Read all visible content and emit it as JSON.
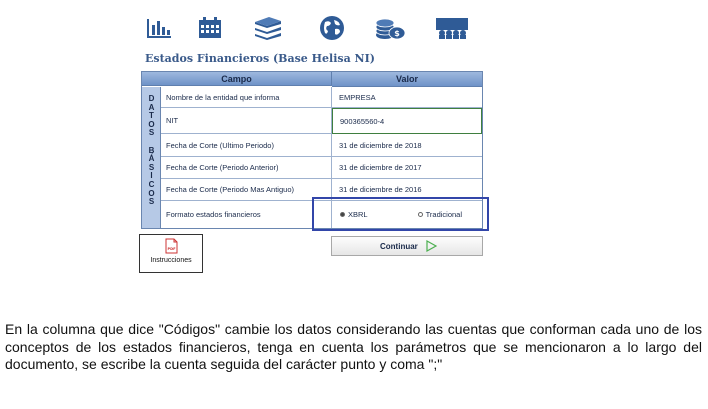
{
  "toolbar": {
    "icons": [
      {
        "name": "bar-chart-icon"
      },
      {
        "name": "calendar-icon"
      },
      {
        "name": "books-icon"
      },
      {
        "name": "globe-icon"
      },
      {
        "name": "coins-icon"
      },
      {
        "name": "meeting-icon"
      }
    ],
    "icon_color": "#2f5b96"
  },
  "form": {
    "title": "Estados Financieros (Base Helisa NI)",
    "columns": {
      "campo": "Campo",
      "valor": "Valor"
    },
    "side_label": "D\nA\nT\nO\nS\n\nB\nÁ\nS\nI\nC\nO\nS",
    "rows": [
      {
        "label": "Nombre de la entidad que informa",
        "value": "EMPRESA"
      },
      {
        "label": "NIT",
        "value": "900365560-4"
      },
      {
        "label": "Fecha de Corte (Ultimo Periodo)",
        "value": "31 de diciembre de 2018"
      },
      {
        "label": "Fecha de Corte (Periodo Anterior)",
        "value": "31 de diciembre de 2017"
      },
      {
        "label": "Fecha de Corte (Periodo Mas Antiguo)",
        "value": "31 de diciembre de 2016"
      },
      {
        "label": "Formato estados financieros",
        "value": ""
      }
    ],
    "format_options": {
      "xbrl": "XBRL",
      "tradicional": "Tradicional",
      "selected": "XBRL"
    },
    "highlight_color": "#3246a9"
  },
  "buttons": {
    "instrucciones": "Instrucciones",
    "pdf_badge": "PDF",
    "continuar": "Continuar"
  },
  "paragraph": "En la columna que dice \"Códigos\" cambie los datos considerando las cuentas que conforman cada uno de los conceptos de los estados financieros, tenga en cuenta los parámetros que se mencionaron a lo largo del documento, se escribe la cuenta seguida del carácter punto y coma \";\""
}
